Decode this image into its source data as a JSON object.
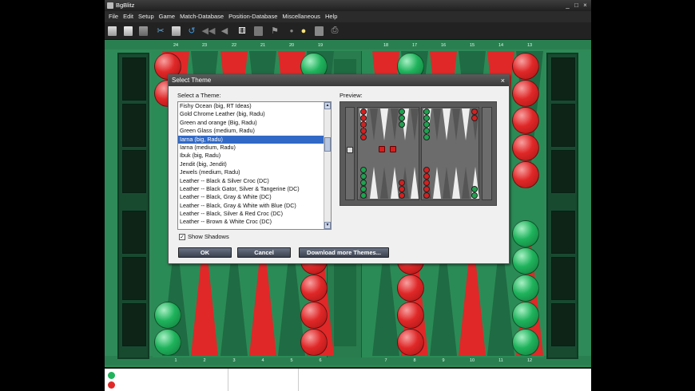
{
  "window": {
    "title": "BgBlitz",
    "minimize": "_",
    "maximize": "□",
    "close": "×"
  },
  "menu": [
    "File",
    "Edit",
    "Setup",
    "Game",
    "Match-Database",
    "Position-Database",
    "Miscellaneous",
    "Help"
  ],
  "toolbar_icons": [
    "new-icon",
    "open-icon",
    "save-icon",
    "tools-icon",
    "export-icon",
    "undo-icon",
    "rewind-icon",
    "back-icon",
    "dice-icon",
    "board-icon",
    "flag-icon",
    "dot-icon",
    "lightbulb-icon",
    "sheet-icon",
    "print-icon"
  ],
  "board": {
    "top_points": [
      "24",
      "23",
      "22",
      "21",
      "20",
      "19",
      "18",
      "17",
      "16",
      "15",
      "14",
      "13"
    ],
    "bottom_points": [
      "1",
      "2",
      "3",
      "4",
      "5",
      "6",
      "7",
      "8",
      "9",
      "10",
      "11",
      "12"
    ],
    "colors": {
      "felt": "#2e8a58",
      "red": "#e02828",
      "green": "#1fb35c"
    }
  },
  "dialog": {
    "title": "Select Theme",
    "close_label": "×",
    "list_label": "Select a Theme:",
    "preview_label": "Preview:",
    "themes": [
      "Fishy Ocean (big, RT Ideas)",
      "Gold Chrome Leather (big, Radu)",
      "Green and orange (Big, Radu)",
      "Green Glass (medium, Radu)",
      "Iarna (big, Radu)",
      "Iarna (medium, Radu)",
      "Ibuk (big, Radu)",
      "Jendit  (big, Jendit)",
      "Jewels (medium, Radu)",
      "Leather -- Black & Silver Croc (DC)",
      "Leather -- Black Gator, Silver & Tangerine (DC)",
      "Leather -- Black, Gray & White (DC)",
      "Leather -- Black, Gray & White with Blue (DC)",
      "Leather -- Black, Silver & Red Croc (DC)",
      "Leather -- Brown & White Croc (DC)"
    ],
    "selected_index": 4,
    "show_shadows_label": "Show Shadows",
    "show_shadows_checked": "✓",
    "ok_label": "OK",
    "cancel_label": "Cancel",
    "download_label": "Download more Themes..."
  }
}
